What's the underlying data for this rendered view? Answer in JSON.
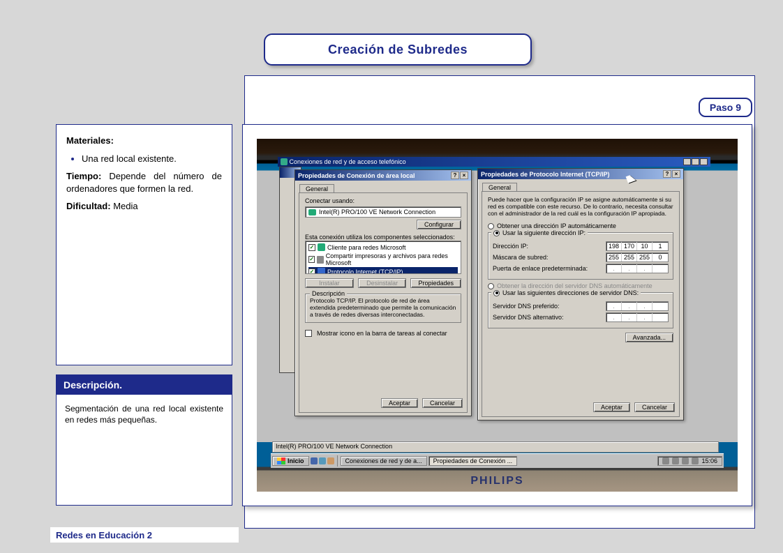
{
  "title": "Creación de Subredes",
  "step_label": "Paso 9",
  "footer": "Redes en Educación 2",
  "materials": {
    "heading": "Materiales:",
    "item1": "Una red local existente.",
    "tiempo_label": "Tiempo:",
    "tiempo_text": "Depende del número de ordenadores que formen la red.",
    "dificultad_label": "Dificultad:",
    "dificultad_text": "Media"
  },
  "description": {
    "heading": "Descripción.",
    "body": "Segmentación de una red local existente en redes más pequeñas."
  },
  "screenshot": {
    "explorer_title": "Conexiones de red y de acceso telefónico",
    "monitor_brand": "PHILIPS",
    "statusbar": "Intel(R) PRO/100 VE Network Connection",
    "taskbar": {
      "start": "Inicio",
      "task1": "Conexiones de red y de a...",
      "task2": "Propiedades de Conexión ...",
      "clock": "15:06"
    },
    "dialog_left": {
      "title": "Propiedades de Conexión de área local",
      "tab": "General",
      "connect_using_label": "Conectar usando:",
      "adapter": "Intel(R) PRO/100 VE Network Connection",
      "configure_btn": "Configurar",
      "components_label": "Esta conexión utiliza los componentes seleccionados:",
      "components": {
        "c1": "Cliente para redes Microsoft",
        "c2": "Compartir impresoras y archivos para redes Microsoft",
        "c3": "Protocolo Internet (TCP/IP)"
      },
      "buttons": {
        "install": "Instalar",
        "uninstall": "Desinstalar",
        "properties": "Propiedades"
      },
      "desc_group": "Descripción",
      "desc_text": "Protocolo TCP/IP. El protocolo de red de área extendida predeterminado que permite la comunicación a través de redes diversas interconectadas.",
      "show_icon": "Mostrar icono en la barra de tareas al conectar",
      "ok": "Aceptar",
      "cancel": "Cancelar"
    },
    "dialog_right": {
      "title": "Propiedades de Protocolo Internet (TCP/IP)",
      "tab": "General",
      "intro": "Puede hacer que la configuración IP se asigne automáticamente si su red es compatible con este recurso. De lo contrario, necesita consultar con el administrador de la red cuál es la configuración IP apropiada.",
      "radio_auto_ip": "Obtener una dirección IP automáticamente",
      "radio_manual_ip": "Usar la siguiente dirección IP:",
      "ip_label": "Dirección IP:",
      "ip": {
        "a": "198",
        "b": "170",
        "c": "10",
        "d": "1"
      },
      "mask_label": "Máscara de subred:",
      "mask": {
        "a": "255",
        "b": "255",
        "c": "255",
        "d": "0"
      },
      "gw_label": "Puerta de enlace predeterminada:",
      "radio_auto_dns": "Obtener la dirección del servidor DNS automáticamente",
      "radio_manual_dns": "Usar las siguientes direcciones de servidor DNS:",
      "dns1_label": "Servidor DNS preferido:",
      "dns2_label": "Servidor DNS alternativo:",
      "advanced": "Avanzada...",
      "ok": "Aceptar",
      "cancel": "Cancelar"
    }
  }
}
